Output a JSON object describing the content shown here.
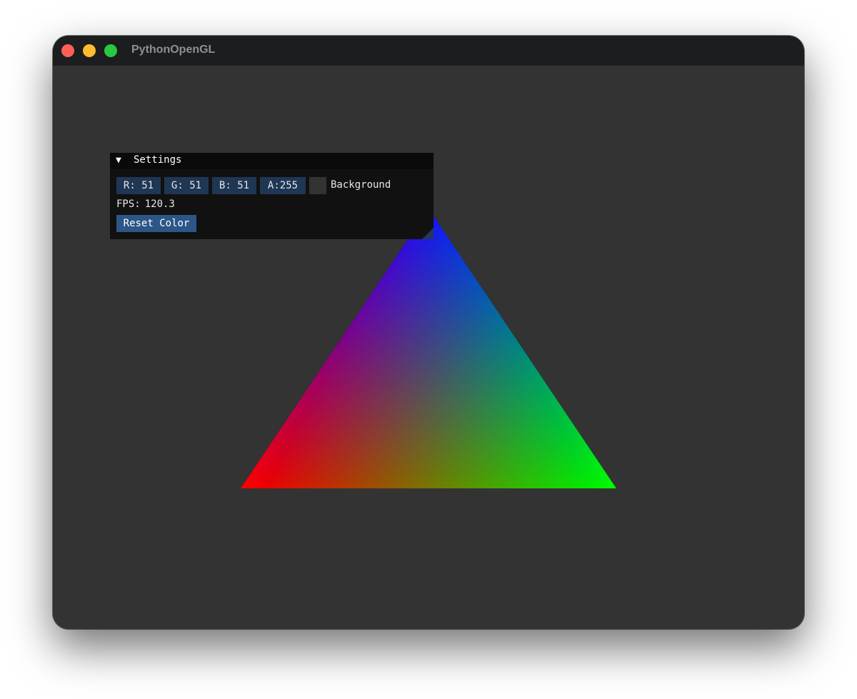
{
  "window": {
    "title": "PythonOpenGL"
  },
  "colors": {
    "background": "#333333",
    "titlebar": "#1c1d1f",
    "traffic_red": "#ff5f57",
    "traffic_yellow": "#febc2e",
    "traffic_green": "#28c840",
    "vertex_top": "#0000ff",
    "vertex_left": "#ff0000",
    "vertex_right": "#00ff00",
    "button": "#2c5687",
    "chip": "#1f3655"
  },
  "settings": {
    "title": "Settings",
    "collapse_icon": "triangle-down-icon",
    "channels": [
      {
        "label": "R:",
        "value": "51"
      },
      {
        "label": "G:",
        "value": "51"
      },
      {
        "label": "B:",
        "value": "51"
      },
      {
        "label": "A:",
        "value": "255"
      }
    ],
    "r_text": "R: 51",
    "g_text": "G: 51",
    "b_text": "B: 51",
    "a_text": "A:255",
    "background_label": "Background",
    "fps_label": "FPS:",
    "fps_value": "120.3",
    "reset_label": "Reset Color"
  }
}
